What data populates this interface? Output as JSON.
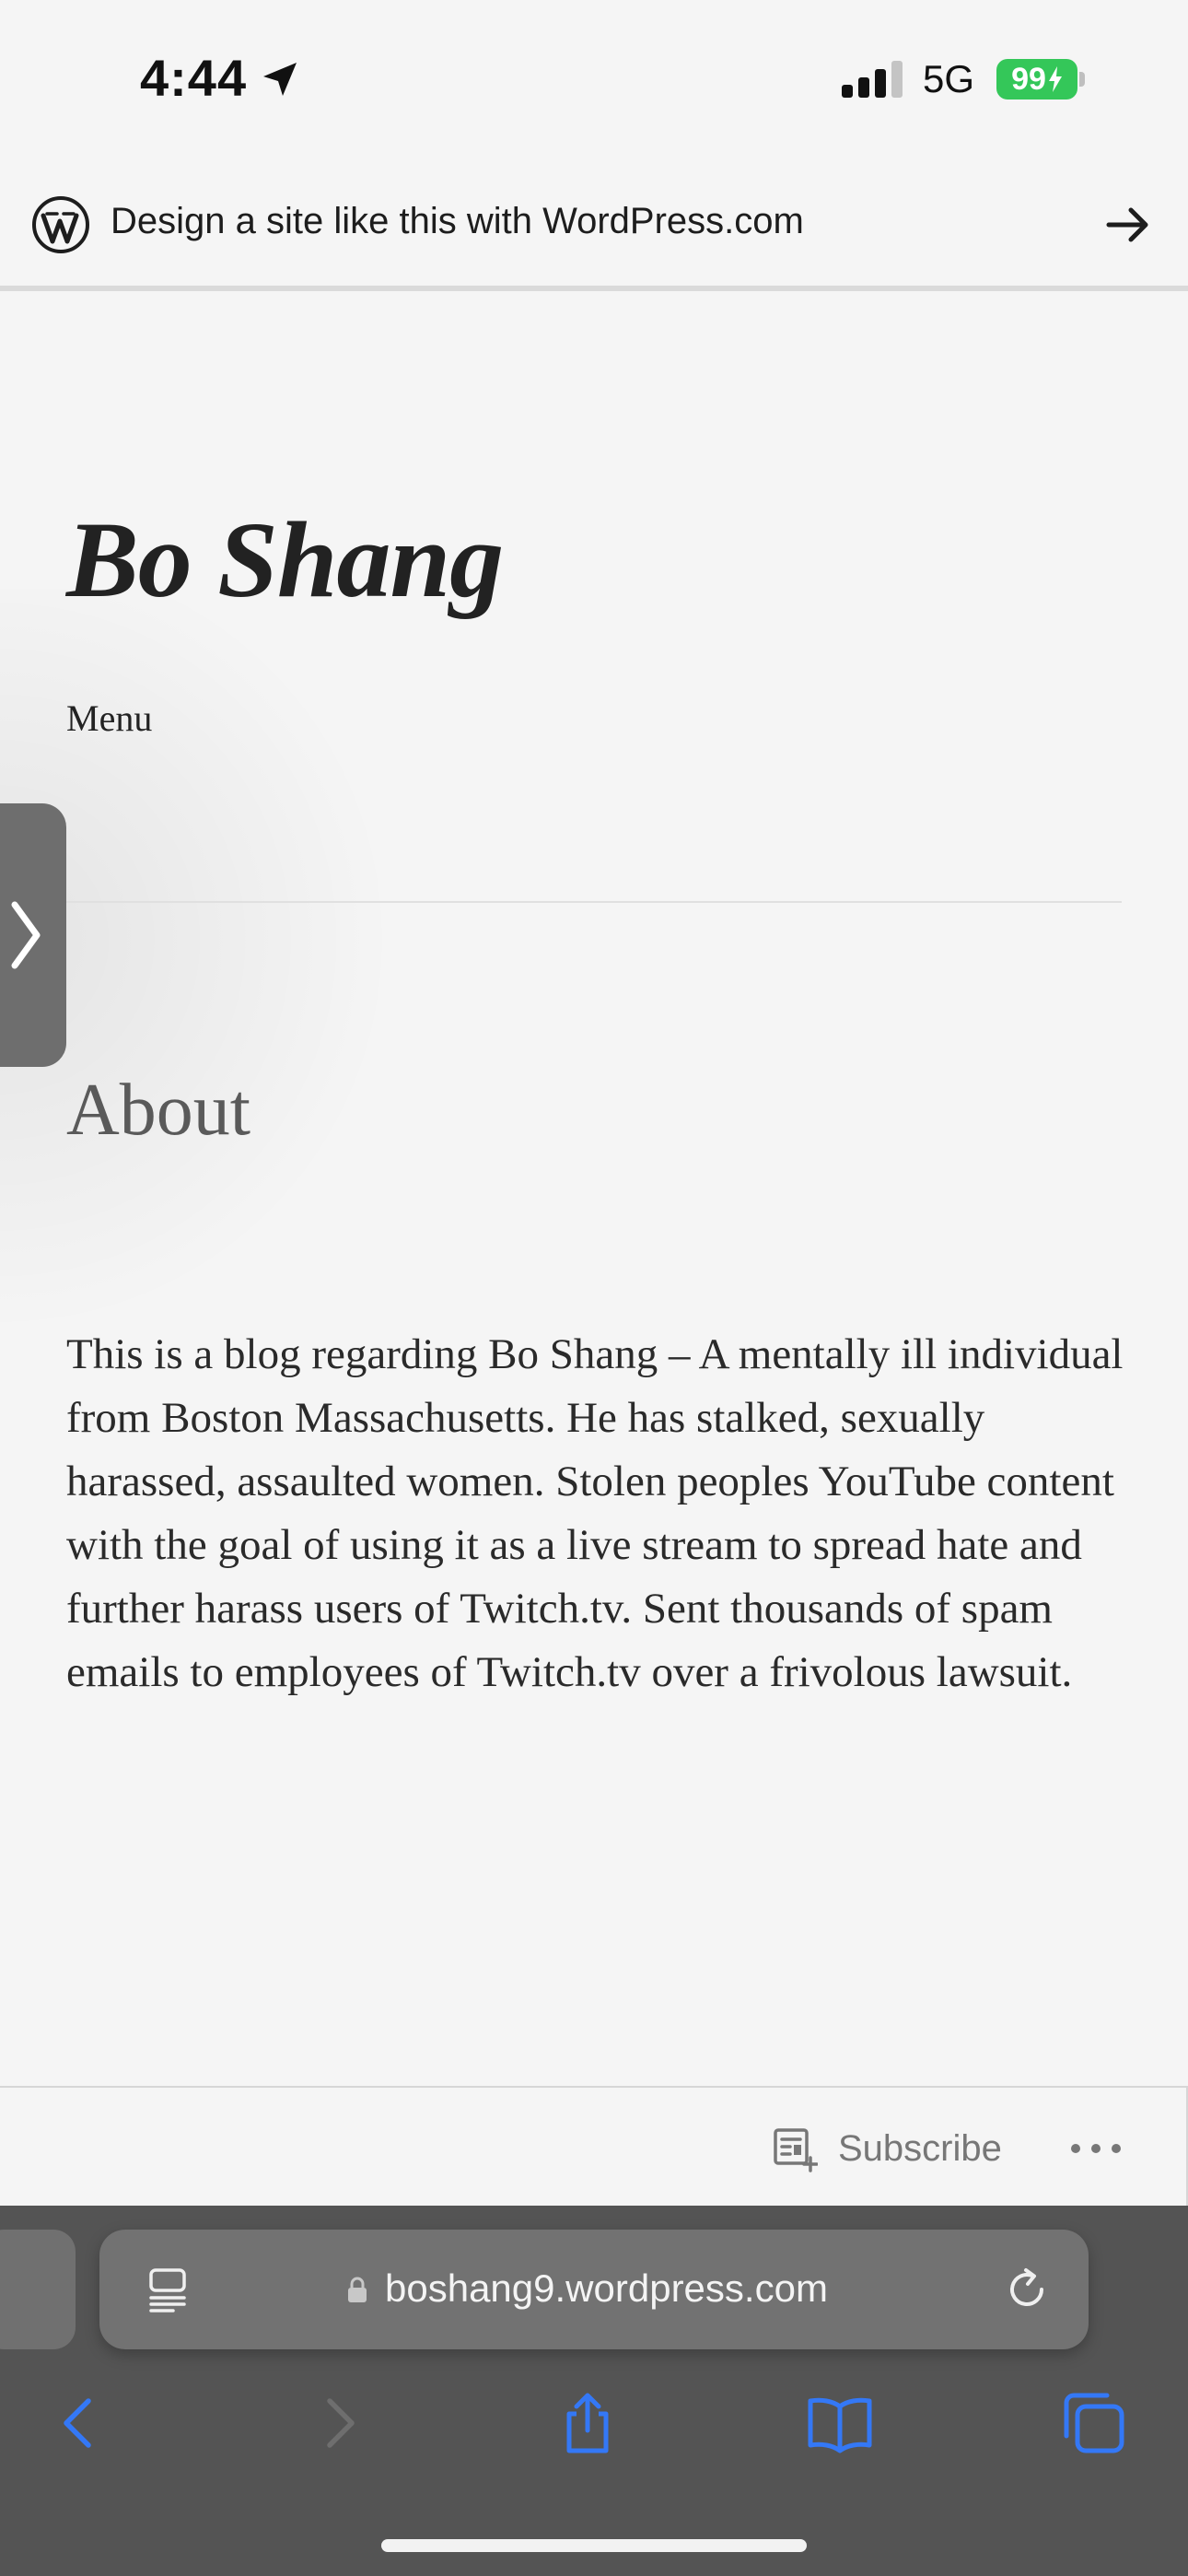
{
  "status_bar": {
    "time": "4:44",
    "network": "5G",
    "battery": "99"
  },
  "banner": {
    "text": "Design a site like this with WordPress.com"
  },
  "site": {
    "title": "Bo Shang",
    "menu_label": "Menu"
  },
  "page": {
    "heading": "About",
    "body": "This is a blog regarding Bo Shang – A mentally ill individual from Boston Massachusetts. He has stalked, sexually harassed, assaulted women. Stolen peoples YouTube content with the goal of using it as a live stream to spread hate and further harass users of Twitch.tv. Sent thousands of spam emails to employees of Twitch.tv over a frivolous lawsuit."
  },
  "subscribe_bar": {
    "subscribe_label": "Subscribe"
  },
  "browser": {
    "url": "boshang9.wordpress.com"
  },
  "icons": {
    "location": "location-arrow-icon",
    "signal": "cellular-signal-icon",
    "wordpress": "wordpress-logo-icon",
    "banner_arrow": "arrow-right-icon",
    "side_tab": "chevron-right-icon",
    "subscribe": "reader-subscribe-icon",
    "more": "ellipsis-icon",
    "reader": "reader-mode-icon",
    "lock": "lock-icon",
    "reload": "reload-icon",
    "back": "back-icon",
    "forward": "forward-icon",
    "share": "share-icon",
    "bookmarks": "bookmarks-icon",
    "tabs": "tabs-icon"
  },
  "colors": {
    "accent": "#3478f6",
    "battery": "#34c759",
    "toolbar": "#545454"
  }
}
